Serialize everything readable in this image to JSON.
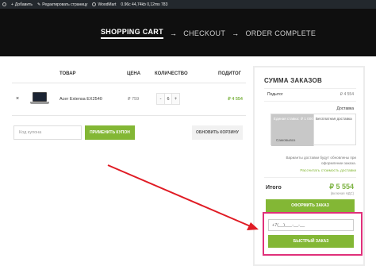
{
  "admin_bar": {
    "items": [
      {
        "icon": "wordpress-icon",
        "label": ""
      },
      {
        "icon": "plus-icon",
        "label": "Добавить"
      },
      {
        "icon": "pencil-icon",
        "label": "Редактировать страницу"
      },
      {
        "icon": "woodmart-icon",
        "label": "WoodMart"
      },
      {
        "icon": "",
        "label": "0.96c  44,74kb  0,12ms  783"
      }
    ]
  },
  "steps": {
    "current": "SHOPPING CART",
    "next": "CHECKOUT",
    "last": "ORDER COMPLETE",
    "arrow_glyph": "→"
  },
  "cart_table": {
    "headers": {
      "product": "ТОВАР",
      "price": "ЦЕНА",
      "quantity": "КОЛИЧЕСТВО",
      "subtotal": "ПОДИТОГ"
    },
    "rows": [
      {
        "remove_glyph": "×",
        "thumbnail": "laptop-icon",
        "name": "Acer Extensa EX2540",
        "price": "₽ 759",
        "qty_minus": "-",
        "qty": "6",
        "qty_plus": "+",
        "subtotal": "₽ 4 554"
      }
    ]
  },
  "coupon": {
    "placeholder": "Код купона",
    "apply_label": "ПРИМЕНИТЬ КУПОН",
    "update_cart_label": "ОБНОВИТЬ КОРЗИНУ"
  },
  "totals": {
    "title": "СУММА ЗАКАЗОВ",
    "subtotal_label": "Подытог",
    "subtotal_value": "₽ 4 554",
    "shipping_label": "Доставка",
    "ship_option_1_label": "Единая ставка:",
    "ship_option_1_value": "₽ 1 000",
    "ship_option_2": "Бесплатная доставка",
    "ship_option_3": "Самовывоз",
    "note": "Варианты доставки будут обновлены при оформлении заказа.",
    "calc_link": "Рассчитать стоимость доставки",
    "total_label": "Итого",
    "total_value": "₽ 5 554",
    "total_tax_note": "(включая НДС)",
    "checkout_label": "ОФОРМИТЬ ЗАКАЗ"
  },
  "quick_order": {
    "phone_value": "+7(__)___-__-__",
    "button_label": "БЫСТРЫЙ ЗАКАЗ"
  },
  "colors": {
    "accent_green": "#83b735",
    "price_green": "#7cb342",
    "highlight_pink": "#e0307a",
    "annotation_red": "#e01b24",
    "hero_black": "#0f0f0f",
    "adminbar": "#23282d"
  }
}
